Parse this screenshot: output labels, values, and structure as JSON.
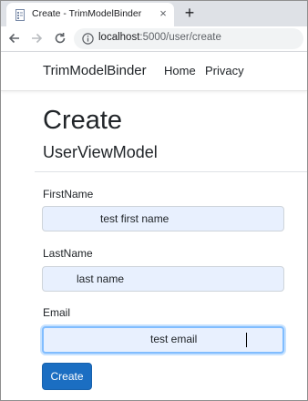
{
  "browser": {
    "tab_title": "Create - TrimModelBinder",
    "close_symbol": "×",
    "new_tab_symbol": "+",
    "url_host": "localhost",
    "url_path": ":5000/user/create",
    "icons": [
      "page-favicon-icon",
      "close-icon",
      "plus-icon",
      "back-arrow-icon",
      "forward-arrow-icon",
      "reload-icon",
      "info-icon"
    ]
  },
  "navbar": {
    "brand": "TrimModelBinder",
    "links": [
      "Home",
      "Privacy"
    ]
  },
  "page": {
    "title": "Create",
    "subtitle": "UserViewModel"
  },
  "form": {
    "fields": [
      {
        "label": "FirstName",
        "value": "test first name"
      },
      {
        "label": "LastName",
        "value": "last name"
      },
      {
        "label": "Email",
        "value": "test email"
      }
    ],
    "submit_label": "Create"
  },
  "colors": {
    "primary_button": "#1b6ec2",
    "autofill_background": "#e8f0fe",
    "focus_border": "#80bdff"
  }
}
